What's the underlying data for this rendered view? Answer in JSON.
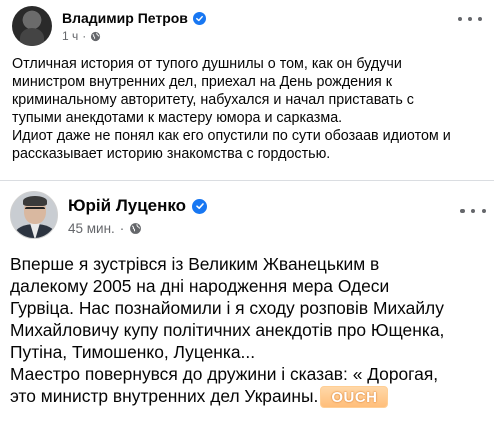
{
  "outer_post": {
    "author": "Владимир Петров",
    "time": "1 ч",
    "text_lines": [
      "Отличная история от тупого душнилы о том, как он будучи",
      "министром внутренних дел, приехал на День рождения к",
      "криминальному авторитету, набухался и начал приставать с",
      "тупыми анекдотами к мастеру юмора и сарказма.",
      "Идиот даже не понял как его опустили по сути обозаав идиотом и",
      "рассказывает историю знакомства с гордостью."
    ]
  },
  "shared_post": {
    "author": "Юрій Луценко",
    "time": "45 мин.",
    "text_lines": [
      "Вперше я зустрівся із Великим Жванецьким в",
      "далекому 2005 на дні народження мера Одеси",
      "Гурвіца. Нас познайомили і я сходу розповів Михайлу",
      "Михайловичу купу політичних анекдотів про Ющенка,",
      "Путіна, Тимошенко, Луценка...",
      "Маестро повернувся до дружини і сказав: « Дорогая,",
      "это министр внутренних дел Украины."
    ],
    "sticker_text": "OUCH"
  },
  "icons": {
    "verified": "verified-badge-icon",
    "privacy": "globe-icon",
    "menu": "more-options-icon"
  },
  "colors": {
    "accent": "#1877f2",
    "meta_text": "#65676b",
    "sticker": "#ffbe7a"
  }
}
